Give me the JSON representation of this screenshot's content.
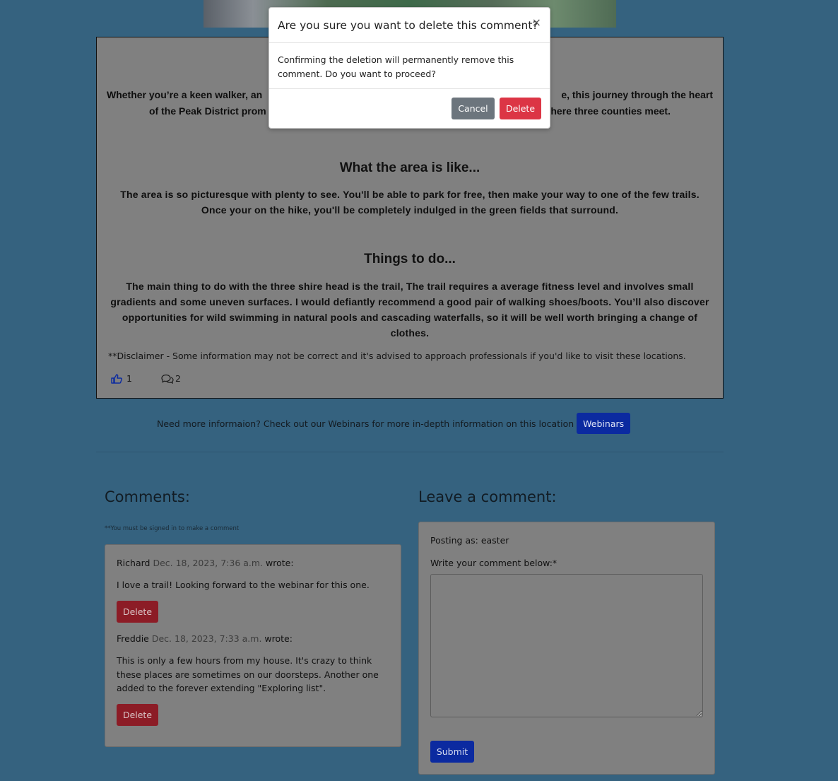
{
  "article": {
    "intro": "Whether you're a keen walker, and to discover a truly captivating landscape, this journey through the heart of the Peak District promises breathtaking views near the spot where three counties meet.",
    "intro_left_1": "Whether you’re a keen walker, an",
    "intro_right_1": "e, this journey through the heart",
    "intro_left_2": "of the Peak District prom",
    "intro_right_2": "here three counties meet.",
    "heading_area": "What the area is like...",
    "para_area": "The area is so picturesque with plenty to see. You'll be able to park for free, then make your way to one of the few trails. Once your on the hike, you'll be completely indulged in the green fields that surround.",
    "heading_things": "Things to do...",
    "para_things": "The main thing to do with the three shire head is the trail, The trail requires a average fitness level and involves small gradients and some uneven surfaces. I would defiantly recommend a good pair of walking shoes/boots. You’ll also discover opportunities for wild swimming in natural pools and cascading waterfalls, so it will be well worth bringing a change of clothes.",
    "disclaimer": "**Disclaimer - Some information may not be correct and it's advised to approach professionals if you'd like to visit these locations.",
    "likes": "1",
    "comment_count": "2",
    "like_icon_color": "#0b2aa0"
  },
  "webinar": {
    "text": "Need more informaion? Check out our Webinars for more in-depth information on this location",
    "button": "Webinars"
  },
  "comments": {
    "title": "Comments:",
    "signin_note": "**You must be signed in to make a comment",
    "items": [
      {
        "author": "Richard",
        "date": "Dec. 18, 2023, 7:36 a.m.",
        "wrote": "wrote:",
        "body": "I love a trail! Looking forward to the webinar for this one.",
        "delete_label": "Delete"
      },
      {
        "author": "Freddie",
        "date": "Dec. 18, 2023, 7:33 a.m.",
        "wrote": "wrote:",
        "body": "This is only a few hours from my house. It's crazy to think these places are sometimes on our doorsteps. Another one added to the forever extending \"Exploring list\".",
        "delete_label": "Delete"
      }
    ]
  },
  "leave_comment": {
    "title": "Leave a comment:",
    "posting_as": "Posting as: easter",
    "label": "Write your comment below:*",
    "textarea_value": "",
    "submit": "Submit"
  },
  "modal": {
    "title": "Are you sure you want to delete this comment?",
    "close": "×",
    "body": "Confirming the deletion will permanently remove this comment. Do you want to proceed?",
    "cancel": "Cancel",
    "delete": "Delete",
    "colors": {
      "cancel": "#6c757d",
      "delete": "#dc3545"
    }
  },
  "colors": {
    "page_background": "#35627f",
    "overlay_gray": "#808080",
    "primary_button": "#0b2aa0"
  }
}
